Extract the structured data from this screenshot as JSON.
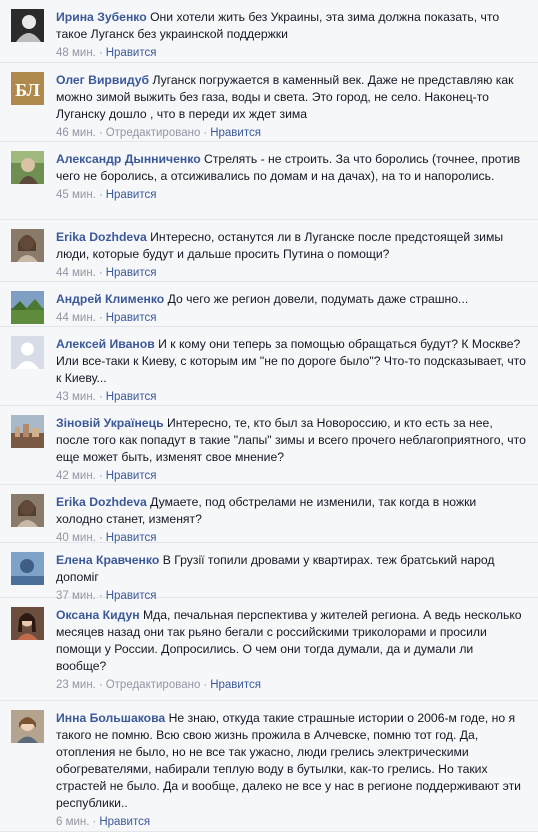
{
  "comments": [
    {
      "author": "Ирина Зубенко",
      "text": "Они хотели жить без Украины, эта зима должна показать, что такое Луганск без украинской поддержки",
      "time": "48 мин.",
      "edited": null,
      "like": "Нравится",
      "avatar": "dark-portrait"
    },
    {
      "author": "Олег Вирвидуб",
      "text": "Луганск погружается в каменный век. Даже не представляю как можно зимой выжить без газа, воды и света. Это город, не село. Наконец-то Луганску дошло , что в переди их ждет зима",
      "time": "46 мин.",
      "edited": "Отредактировано",
      "like": "Нравится",
      "avatar": "logo-bl"
    },
    {
      "author": "Александр Дынниченко",
      "text": "Стрелять - не строить. За что боролись (точнее, против чего не боролись, а отсиживались по домам и на дачах), на то и напоролись.",
      "time": "45 мин.",
      "edited": null,
      "like": "Нравится",
      "avatar": "outdoor-man"
    },
    {
      "author": "Erika Dozhdeva",
      "text": "Интересно, останутся ли в Луганске после предстоящей зимы люди, которые будут и дальше просить Путина о помощи?",
      "time": "44 мин.",
      "edited": null,
      "like": "Нравится",
      "avatar": "woman-portrait"
    },
    {
      "author": "Андрей Клименко",
      "text": "До чего же регион довели, подумать даже страшно...",
      "time": "44 мин.",
      "edited": null,
      "like": "Нравится",
      "avatar": "landscape"
    },
    {
      "author": "Алексей Иванов",
      "text": "И к кому они теперь за помощью обращаться будут? К Москве? Или все-таки к Киеву, с которым им \"не по дороге было\"? Что-то подсказывает, что к Киеву...",
      "time": "43 мин.",
      "edited": null,
      "like": "Нравится",
      "avatar": "default-silhouette"
    },
    {
      "author": "Зіновій Українець",
      "text": "Интересно, те, кто был за Новороссию, и кто есть за нее, после того как попадут в такие \"лапы\" зимы и всего прочего неблагоприятного, что еще может быть, изменят свое мнение?",
      "time": "42 мин.",
      "edited": null,
      "like": "Нравится",
      "avatar": "city-view"
    },
    {
      "author": "Erika Dozhdeva",
      "text": "Думаете, под обстрелами не изменили, так когда в ножки холодно станет, изменят?",
      "time": "40 мин.",
      "edited": null,
      "like": "Нравится",
      "avatar": "woman-portrait"
    },
    {
      "author": "Елена Кравченко",
      "text": "В Грузії топили дровами у квартирах. теж братський народ допоміг",
      "time": "37 мин.",
      "edited": null,
      "like": "Нравится",
      "avatar": "blue-scene"
    },
    {
      "author": "Оксана Кидун",
      "text": "Мда, печальная перспектива у жителей региона. А ведь несколько месяцев назад они так рьяно бегали с российскими триколорами и просили помощи у России. Допросились. О чем они тогда думали, да и думали ли вообще?",
      "time": "23 мин.",
      "edited": "Отредактировано",
      "like": "Нравится",
      "avatar": "brunette-portrait"
    },
    {
      "author": "Инна Большакова",
      "text": "Не знаю, откуда такие страшные истории о 2006-м годе, но я такого не помню. Всю свою жизнь прожила в Алчевске, помню тот год. Да, отопления не было, но не все так ужасно, люди грелись электрическими обогревателями, набирали теплую воду в бутылки, как-то грелись. Но таких страстей не было. Да и вообще, далеко не все у нас в регионе поддерживают эти республики..",
      "time": "6 мин.",
      "edited": null,
      "like": "Нравится",
      "avatar": "woman-smile"
    }
  ]
}
